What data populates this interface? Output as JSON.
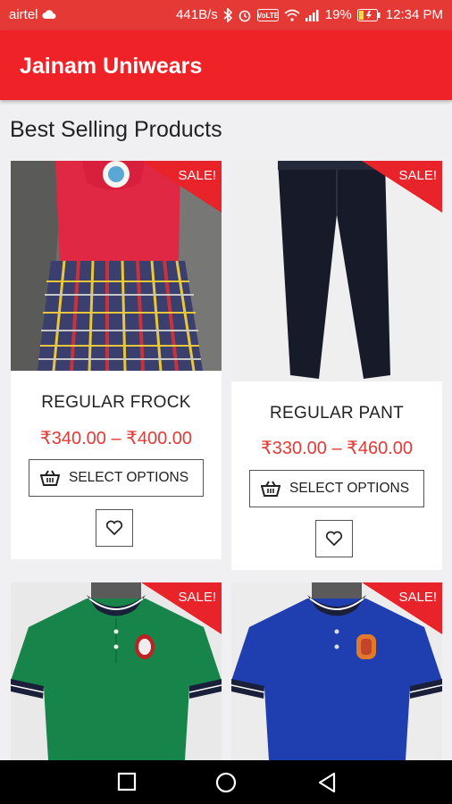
{
  "status_bar": {
    "carrier": "airtel",
    "speed": "441B/s",
    "battery": "19%",
    "time": "12:34 PM"
  },
  "app_bar": {
    "title": "Jainam Uniwears"
  },
  "section": {
    "title": "Best Selling Products"
  },
  "products": [
    {
      "name": "REGULAR FROCK",
      "price": "₹340.00 – ₹400.00",
      "badge": "SALE!",
      "button_label": "SELECT OPTIONS"
    },
    {
      "name": "REGULAR PANT",
      "price": "₹330.00 – ₹460.00",
      "badge": "SALE!",
      "button_label": "SELECT OPTIONS"
    },
    {
      "badge": "SALE!"
    },
    {
      "badge": "SALE!"
    }
  ],
  "colors": {
    "accent": "#ef2227",
    "price": "#e53935"
  }
}
